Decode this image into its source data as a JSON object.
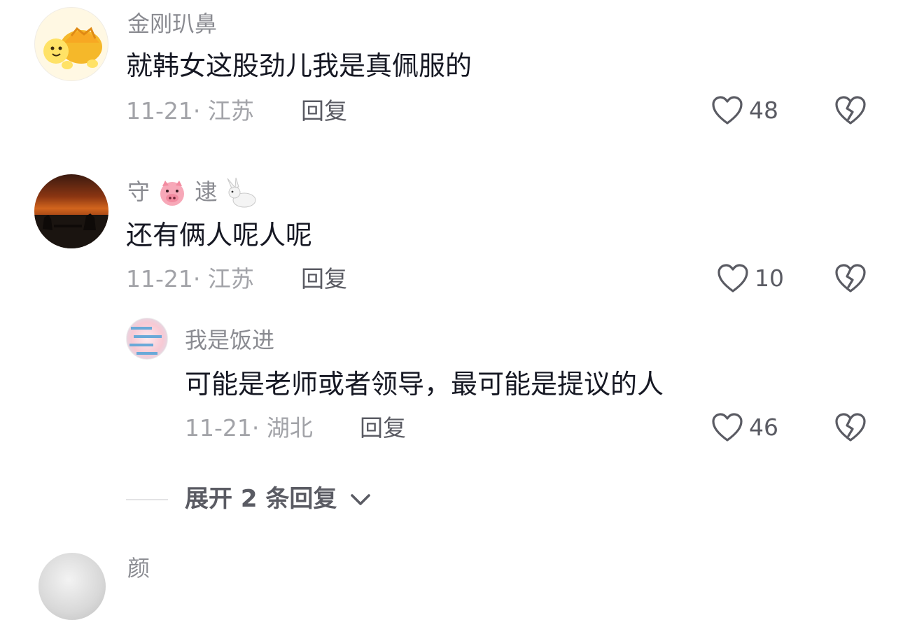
{
  "comments": [
    {
      "username": "金刚玐鼻",
      "text": "就韩女这股劲儿我是真佩服的",
      "meta": "11-21· 江苏",
      "reply_label": "回复",
      "likes": "48"
    },
    {
      "username_parts": [
        "守",
        "逮"
      ],
      "text": "还有俩人呢人呢",
      "meta": "11-21· 江苏",
      "reply_label": "回复",
      "likes": "10",
      "replies": [
        {
          "username": "我是饭进",
          "text": "可能是老师或者领导，最可能是提议的人",
          "meta": "11-21· 湖北",
          "reply_label": "回复",
          "likes": "46"
        }
      ],
      "expand_label": "展开 2 条回复"
    },
    {
      "username": "颜"
    }
  ],
  "icons": {
    "like": "heart-outline-icon",
    "dislike": "broken-heart-icon",
    "expand": "chevron-down-icon",
    "username_emoji_1": "pig-face-emoji",
    "username_emoji_2": "rabbit-emoji"
  },
  "colors": {
    "username": "#8a8b91",
    "text": "#161823",
    "meta": "#a2a3a8",
    "action": "#5a5b63"
  }
}
